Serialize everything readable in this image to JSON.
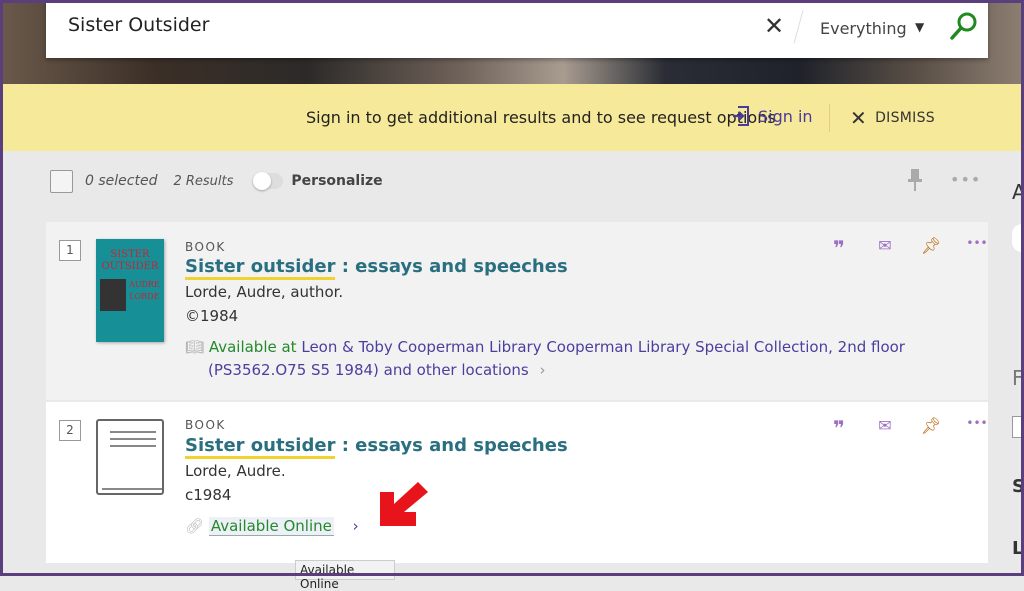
{
  "search": {
    "query": "Sister Outsider",
    "scope": "Everything",
    "colors": {
      "search_icon": "#1f8a1f"
    }
  },
  "banner": {
    "message": "Sign in to get additional results and to see request options",
    "signin": "Sign in",
    "dismiss": "DISMISS"
  },
  "toolbar": {
    "selected": "0 selected",
    "results": "2 Results",
    "personalize": "Personalize"
  },
  "results": [
    {
      "number": "1",
      "type": "BOOK",
      "title_hl": "Sister outsider",
      "title_rest": " : essays and speeches",
      "author": "Lorde, Audre, author.",
      "date": "©1984",
      "availability_status": "Available at",
      "location": "Leon & Toby Cooperman Library  Cooperman Library Special Collection, 2nd floor",
      "callnumber": "(PS3562.O75 S5 1984) and other locations",
      "cover_text": [
        "SISTER",
        "OUTSIDER",
        "AUDRE",
        "LORDE"
      ]
    },
    {
      "number": "2",
      "type": "BOOK",
      "title_hl": "Sister outsider",
      "title_rest": " : essays and speeches",
      "author": "Lorde, Audre.",
      "date": "c1984",
      "availability_status": "Available Online"
    }
  ],
  "tooltip": "Available Online",
  "sidebar_partial": [
    "A",
    "F",
    "S",
    "L"
  ],
  "colors": {
    "frame": "#5b3f7c",
    "banner": "#f7e99a",
    "title": "#2a6f80",
    "available": "#238a2a",
    "link": "#4b3f9e",
    "pin": "#b8650a",
    "arrow": "#e8141b"
  }
}
